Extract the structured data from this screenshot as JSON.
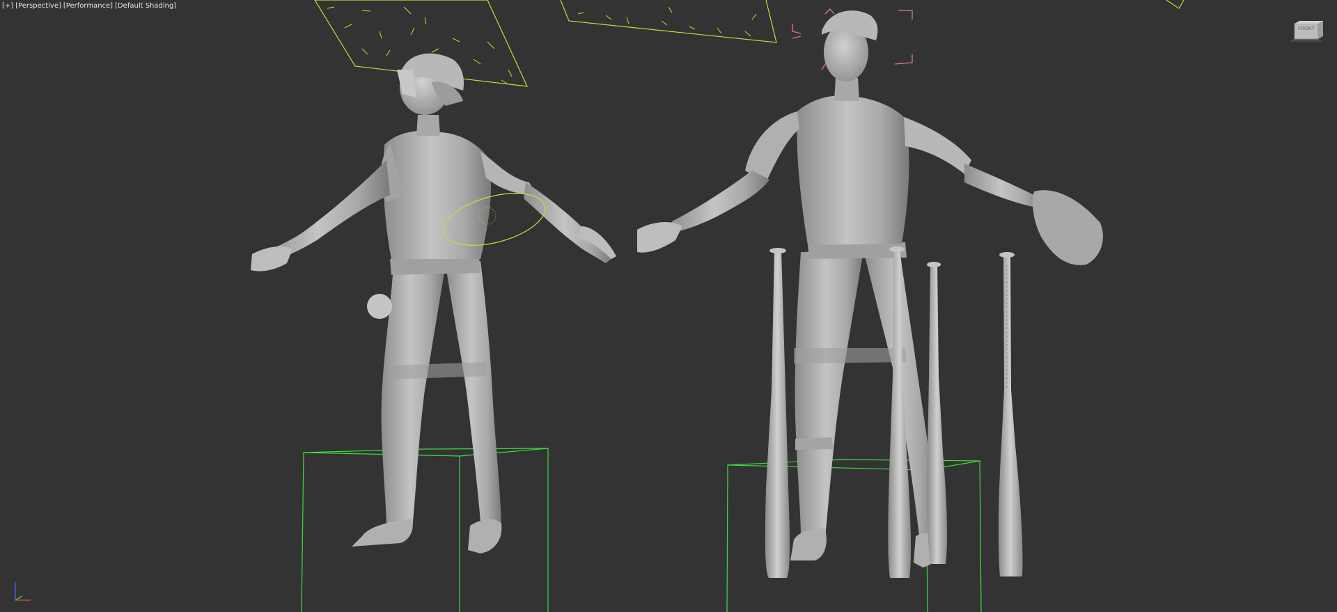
{
  "viewport": {
    "label_segments": [
      "[+]",
      "[Perspective]",
      "[Performance]",
      "[Default Shading]"
    ],
    "viewcube_label": "FRONT"
  },
  "colors": {
    "background": "#333333",
    "model_shade": "#b5b5b5",
    "selection_green": "#3ddc3d",
    "light_yellow": "#d6d63a",
    "camera_pink": "#e070b0",
    "label_text": "#e6e6e6"
  },
  "scene_objects": [
    {
      "name": "baseball-player-left",
      "type": "mesh"
    },
    {
      "name": "baseball-player-right",
      "type": "mesh"
    },
    {
      "name": "baseball-bat-1",
      "type": "mesh"
    },
    {
      "name": "baseball-bat-2",
      "type": "mesh"
    },
    {
      "name": "baseball-bat-3",
      "type": "mesh"
    },
    {
      "name": "baseball-bat-4",
      "type": "mesh"
    },
    {
      "name": "baseball-glove",
      "type": "mesh"
    },
    {
      "name": "baseball",
      "type": "mesh"
    },
    {
      "name": "area-light-left",
      "type": "light"
    },
    {
      "name": "area-light-center",
      "type": "light"
    },
    {
      "name": "area-light-right",
      "type": "light"
    },
    {
      "name": "spot-light-ellipse",
      "type": "light"
    },
    {
      "name": "camera-target",
      "type": "helper"
    }
  ]
}
